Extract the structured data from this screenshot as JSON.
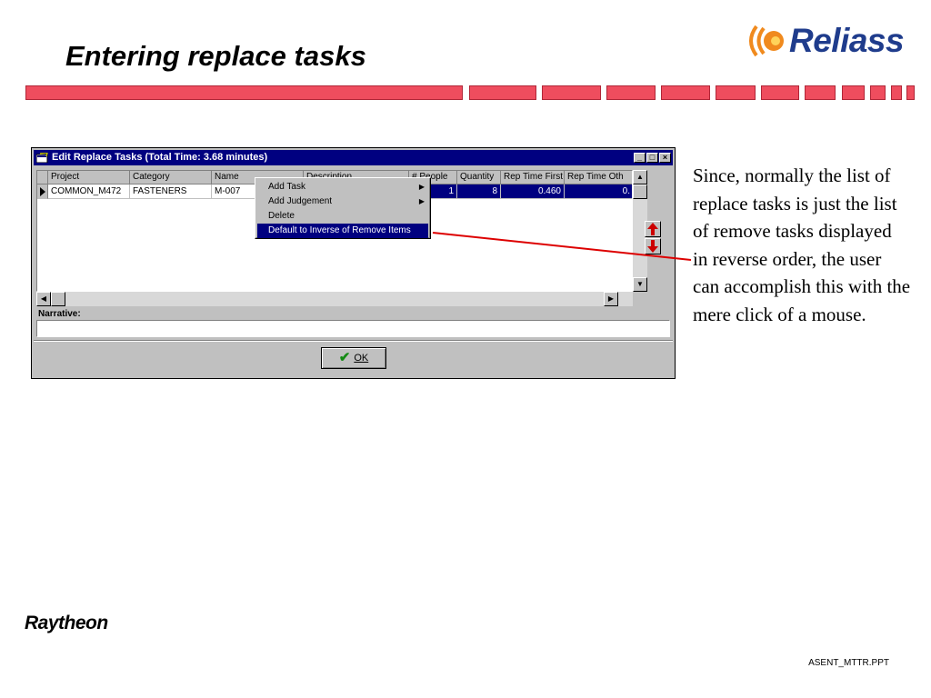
{
  "slide": {
    "title": "Entering replace tasks",
    "logo_text": "Reliass",
    "footer_logo": "Raytheon",
    "footer_text": "ASENT_MTTR.PPT",
    "callout": "Since, normally the list of replace tasks is just the list of remove tasks displayed in reverse order, the user can accomplish this with the mere click of a mouse.",
    "accent_color": "#ef4d5e",
    "logo_color": "#1f3c8c"
  },
  "window": {
    "title": "Edit Replace Tasks  (Total Time:  3.68 minutes)",
    "titlebar_color": "#000080",
    "columns": [
      "Project",
      "Category",
      "Name",
      "Description",
      "# People",
      "Quantity",
      "Rep Time First",
      "Rep Time Oth"
    ],
    "row": [
      "COMMON_M472",
      "FASTENERS",
      "M-007",
      "",
      "1",
      "8",
      "0.460",
      "0."
    ],
    "narrative_label": "Narrative:",
    "ok_label": "OK",
    "context_menu": [
      "Add Task",
      "Add Judgement",
      "Delete",
      "Default to Inverse of Remove Items"
    ]
  },
  "icons": {
    "window": "window-icon",
    "minimize": "minimize-icon",
    "maximize": "maximize-icon",
    "close": "close-icon",
    "row_indicator": "row-pointer-icon",
    "move_up": "move-up-arrow-icon",
    "move_down": "move-down-arrow-icon",
    "ok": "checkmark-icon",
    "submenu": "submenu-arrow-icon"
  }
}
